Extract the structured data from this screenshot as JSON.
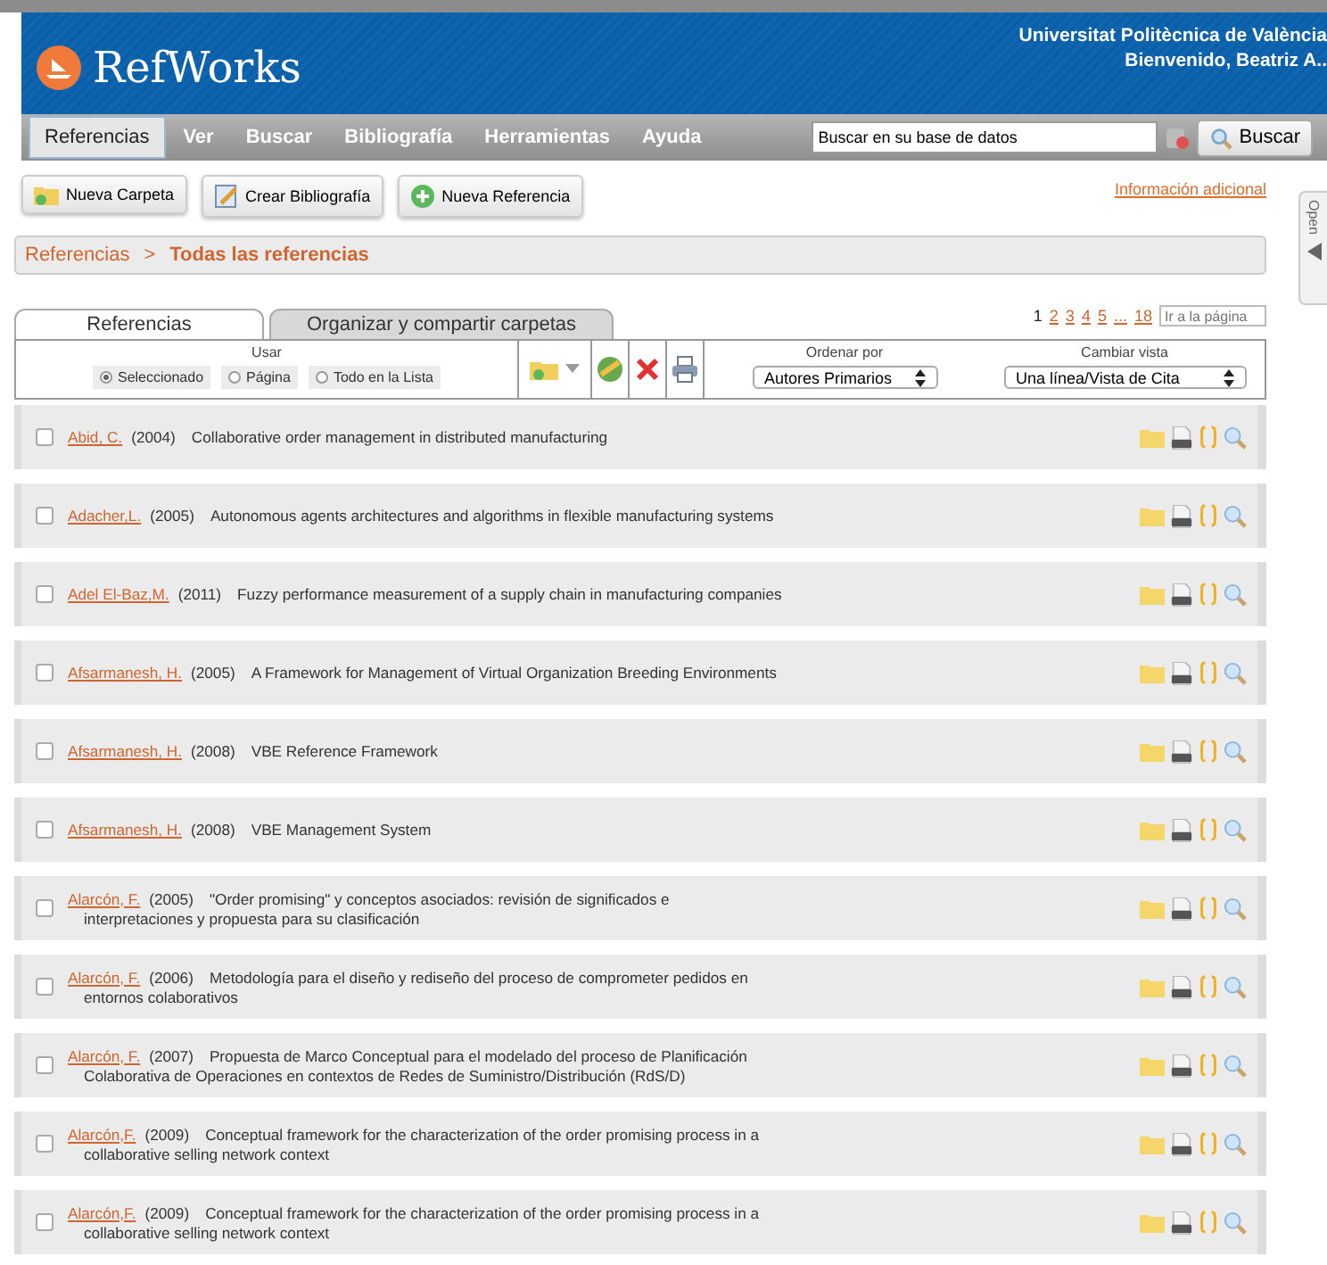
{
  "header": {
    "logo": "RefWorks",
    "institution": "Universitat Politècnica de València",
    "welcome": "Bienvenido, Beatriz A.."
  },
  "nav": [
    {
      "label": "Referencias",
      "selected": true
    },
    {
      "label": "Ver",
      "selected": false
    },
    {
      "label": "Buscar",
      "selected": false
    },
    {
      "label": "Bibliografía",
      "selected": false
    },
    {
      "label": "Herramientas",
      "selected": false
    },
    {
      "label": "Ayuda",
      "selected": false
    }
  ],
  "search": {
    "value": "Buscar en su base de datos",
    "button": "Buscar"
  },
  "actions": [
    "Nueva Carpeta",
    "Crear Bibliografía",
    "Nueva Referencia"
  ],
  "info_link": "Información adicional",
  "side_tab": "Open",
  "breadcrumb": {
    "parent": "Referencias",
    "separator": ">",
    "current": "Todas las referencias"
  },
  "tabs": [
    {
      "label": "Referencias",
      "selected": true
    },
    {
      "label": "Organizar y compartir carpetas",
      "selected": false
    }
  ],
  "pagination": {
    "pages": [
      {
        "label": "1",
        "selected": true
      },
      {
        "label": "2",
        "selected": false
      },
      {
        "label": "3",
        "selected": false
      },
      {
        "label": "4",
        "selected": false
      },
      {
        "label": "5",
        "selected": false
      },
      {
        "label": "...",
        "selected": false
      },
      {
        "label": "18",
        "selected": false
      }
    ],
    "goto_placeholder": "Ir a la página"
  },
  "use": {
    "label": "Usar",
    "options": [
      {
        "label": "Seleccionado",
        "selected": true
      },
      {
        "label": "Página",
        "selected": false
      },
      {
        "label": "Todo en la Lista",
        "selected": false
      }
    ]
  },
  "sort": {
    "label": "Ordenar por",
    "value": "Autores Primarios"
  },
  "view": {
    "label": "Cambiar vista",
    "value": "Una línea/Vista de Cita"
  },
  "references": [
    {
      "author": "Abid, C.",
      "year": "(2004)",
      "title": "Collaborative order management in distributed manufacturing",
      "checked": false
    },
    {
      "author": "Adacher,L.",
      "year": "(2005)",
      "title": "Autonomous agents architectures and algorithms in flexible manufacturing systems",
      "checked": false
    },
    {
      "author": "Adel El-Baz,M.",
      "year": "(2011)",
      "title": "Fuzzy performance measurement of a supply chain in manufacturing companies",
      "checked": false
    },
    {
      "author": "Afsarmanesh, H.",
      "year": "(2005)",
      "title": "A Framework for Management of Virtual Organization Breeding Environments",
      "checked": false
    },
    {
      "author": "Afsarmanesh, H.",
      "year": "(2008)",
      "title": "VBE Reference Framework",
      "checked": false
    },
    {
      "author": "Afsarmanesh, H.",
      "year": "(2008)",
      "title": "VBE Management System",
      "checked": false
    },
    {
      "author": "Alarcón, F.",
      "year": "(2005)",
      "title": "\"Order promising\" y conceptos asociados: revisión de significados e",
      "title_2": "interpretaciones y propuesta para su clasificación",
      "checked": false
    },
    {
      "author": "Alarcón, F.",
      "year": "(2006)",
      "title": "Metodología para el diseño y rediseño del proceso de comprometer pedidos en",
      "title_2": "entornos colaborativos",
      "checked": false
    },
    {
      "author": "Alarcón, F.",
      "year": "(2007)",
      "title": "Propuesta de Marco Conceptual para el modelado del proceso de Planificación",
      "title_2": "Colaborativa de Operaciones en contextos de Redes de Suministro/Distribución (RdS/D)",
      "checked": false
    },
    {
      "author": "Alarcón,F.",
      "year": "(2009)",
      "title": "Conceptual framework for the characterization of the order promising process in a",
      "title_2": "collaborative selling network context",
      "checked": false
    },
    {
      "author": "Alarcón,F.",
      "year": "(2009)",
      "title": "Conceptual framework for the characterization of the order promising process in a",
      "title_2": "collaborative selling network context",
      "checked": false
    }
  ]
}
